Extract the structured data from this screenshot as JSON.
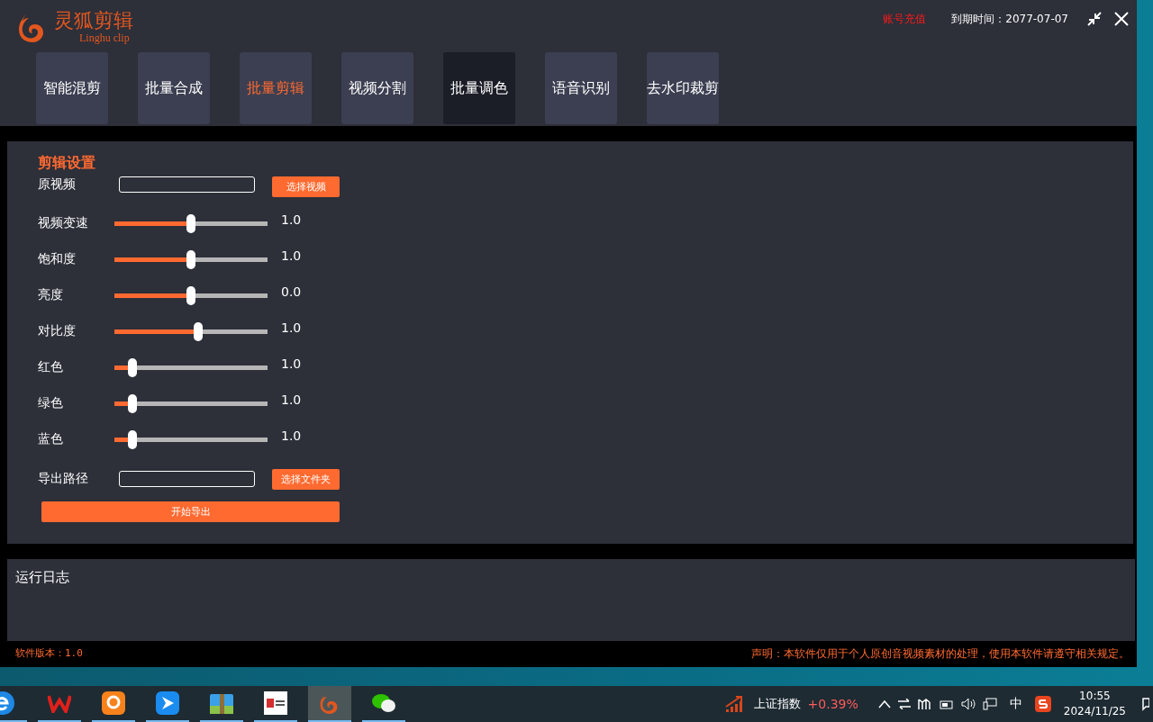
{
  "logo": {
    "title": "灵狐剪辑",
    "subtitle": "Linghu clip"
  },
  "header": {
    "recharge": "账号充值",
    "expiry": "到期时间：2077-07-07"
  },
  "tabs": [
    {
      "label": "智能混剪",
      "selected": false,
      "hovered": false
    },
    {
      "label": "批量合成",
      "selected": false,
      "hovered": false
    },
    {
      "label": "批量剪辑",
      "selected": true,
      "hovered": false
    },
    {
      "label": "视频分割",
      "selected": false,
      "hovered": false
    },
    {
      "label": "批量调色",
      "selected": false,
      "hovered": true
    },
    {
      "label": "语音识别",
      "selected": false,
      "hovered": false
    },
    {
      "label": "去水印裁剪",
      "selected": false,
      "hovered": false
    }
  ],
  "settings": {
    "title": "剪辑设置",
    "source": {
      "label": "原视频",
      "button": "选择视频"
    },
    "sliders": [
      {
        "label": "视频变速",
        "level": 0.5,
        "reading": "1.0"
      },
      {
        "label": "饱和度",
        "level": 0.5,
        "reading": "1.0"
      },
      {
        "label": "亮度",
        "level": 0.5,
        "reading": "0.0"
      },
      {
        "label": "对比度",
        "level": 0.545,
        "reading": "1.0"
      },
      {
        "label": "红色",
        "level": 0.12,
        "reading": "1.0"
      },
      {
        "label": "绿色",
        "level": 0.12,
        "reading": "1.0"
      },
      {
        "label": "蓝色",
        "level": 0.12,
        "reading": "1.0"
      }
    ],
    "output": {
      "label": "导出路径",
      "button": "选择文件夹"
    },
    "start_button": "开始导出"
  },
  "log": {
    "title": "运行日志"
  },
  "footer": {
    "version": "软件版本：1.0",
    "notice": "声明：本软件仅用于个人原创音视频素材的处理，使用本软件请遵守相关规定。"
  },
  "taskbar": {
    "apps": [
      {
        "kind": "browser",
        "active": false
      },
      {
        "kind": "office",
        "active": false
      },
      {
        "kind": "squirrel",
        "active": false
      },
      {
        "kind": "plane",
        "active": false
      },
      {
        "kind": "archive",
        "active": false
      },
      {
        "kind": "news",
        "active": false
      },
      {
        "kind": "fox",
        "active": true
      },
      {
        "kind": "chat",
        "active": false
      }
    ],
    "tray": {
      "stock_name": "上证指数",
      "stock_change": "+0.39%",
      "input_method": "中",
      "time": "10:55",
      "date": "2024/11/25"
    }
  }
}
